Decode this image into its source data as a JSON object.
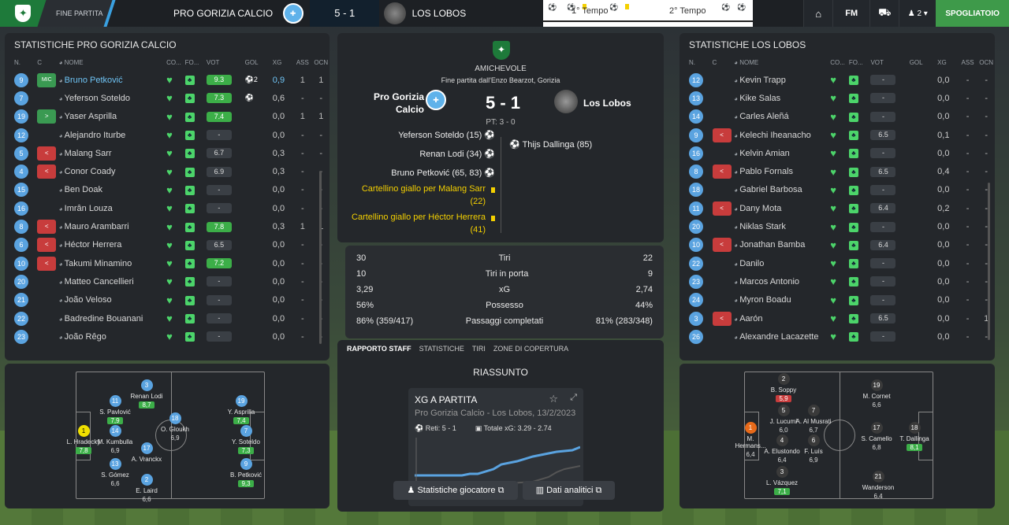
{
  "topbar": {
    "status": "FINE PARTITA",
    "home": "PRO GORIZIA CALCIO",
    "score": "5 - 1",
    "away": "LOS LOBOS",
    "first_half": "1° Tempo",
    "second_half": "2° Tempo",
    "fm": "FM",
    "inbox_count": "2",
    "spogliatoio": "SPOGLIATOIO"
  },
  "left": {
    "title": "STATISTICHE PRO GORIZIA CALCIO",
    "headers": {
      "n": "N.",
      "c": "C",
      "nome": "NOME",
      "co": "CO...",
      "fo": "FO...",
      "vot": "VOT",
      "gol": "GOL",
      "xg": "XG",
      "ass": "ASS",
      "ocn": "OCN"
    },
    "rows": [
      {
        "n": "9",
        "sub": "MIC",
        "name": "Bruno Petković",
        "vot": "9.3",
        "gol": "2",
        "xg": "0,9",
        "ass": "1",
        "ocn": "1"
      },
      {
        "n": "7",
        "sub": "",
        "name": "Yeferson Soteldo",
        "vot": "7.3",
        "gol": "1",
        "xg": "0,6",
        "ass": "-",
        "ocn": "-"
      },
      {
        "n": "19",
        "sub": ">",
        "name": "Yaser Asprilla",
        "vot": "7.4",
        "gol": "",
        "xg": "0,0",
        "ass": "1",
        "ocn": "1"
      },
      {
        "n": "12",
        "sub": "",
        "name": "Alejandro Iturbe",
        "vot": "-",
        "gol": "",
        "xg": "0,0",
        "ass": "-",
        "ocn": "-"
      },
      {
        "n": "5",
        "sub": "<",
        "name": "Malang Sarr",
        "vot": "6.7",
        "gol": "",
        "xg": "0,3",
        "ass": "-",
        "ocn": "-"
      },
      {
        "n": "4",
        "sub": "<",
        "name": "Conor Coady",
        "vot": "6.9",
        "gol": "",
        "xg": "0,3",
        "ass": "-",
        "ocn": "-"
      },
      {
        "n": "15",
        "sub": "",
        "name": "Ben Doak",
        "vot": "-",
        "gol": "",
        "xg": "0,0",
        "ass": "-",
        "ocn": "-"
      },
      {
        "n": "16",
        "sub": "",
        "name": "Imrân Louza",
        "vot": "-",
        "gol": "",
        "xg": "0,0",
        "ass": "-",
        "ocn": "-"
      },
      {
        "n": "8",
        "sub": "<",
        "name": "Mauro Arambarri",
        "vot": "7.8",
        "gol": "",
        "xg": "0,3",
        "ass": "1",
        "ocn": "1"
      },
      {
        "n": "6",
        "sub": "<",
        "name": "Héctor Herrera",
        "vot": "6.5",
        "gol": "",
        "xg": "0,0",
        "ass": "-",
        "ocn": "-"
      },
      {
        "n": "10",
        "sub": "<",
        "name": "Takumi Minamino",
        "vot": "7.2",
        "gol": "",
        "xg": "0,0",
        "ass": "-",
        "ocn": "-"
      },
      {
        "n": "20",
        "sub": "",
        "name": "Matteo Cancellieri",
        "vot": "-",
        "gol": "",
        "xg": "0,0",
        "ass": "-",
        "ocn": "-"
      },
      {
        "n": "21",
        "sub": "",
        "name": "João Veloso",
        "vot": "-",
        "gol": "",
        "xg": "0,0",
        "ass": "-",
        "ocn": "-"
      },
      {
        "n": "22",
        "sub": "",
        "name": "Badredine Bouanani",
        "vot": "-",
        "gol": "",
        "xg": "0,0",
        "ass": "-",
        "ocn": "-"
      },
      {
        "n": "23",
        "sub": "",
        "name": "João Rêgo",
        "vot": "-",
        "gol": "",
        "xg": "0,0",
        "ass": "-",
        "ocn": "-"
      }
    ],
    "pitch": [
      {
        "n": "3",
        "name": "Renan Lodi",
        "rt": "8,7",
        "g": true
      },
      {
        "n": "11",
        "name": "S. Pavlović",
        "rt": "7,9",
        "g": true
      },
      {
        "n": "14",
        "name": "M. Kumbulla",
        "rt": "6,9",
        "g": false
      },
      {
        "n": "1",
        "name": "L. Hradecký",
        "rt": "7,8",
        "g": true
      },
      {
        "n": "13",
        "name": "S. Gómez",
        "rt": "6,6",
        "g": false
      },
      {
        "n": "2",
        "name": "E. Laird",
        "rt": "6,6",
        "g": false
      },
      {
        "n": "18",
        "name": "O. Gloukh",
        "rt": "6,9",
        "g": false
      },
      {
        "n": "17",
        "name": "A. Vranckx",
        "rt": "",
        "g": false
      },
      {
        "n": "19",
        "name": "Y. Asprilla",
        "rt": "7,4",
        "g": true
      },
      {
        "n": "7",
        "name": "Y. Soteldo",
        "rt": "7,3",
        "g": true
      },
      {
        "n": "9",
        "name": "B. Petković",
        "rt": "9,3",
        "g": true
      }
    ]
  },
  "center": {
    "competition": "AMICHEVOLE",
    "venue": "Fine partita dall'Enzo Bearzot, Gorizia",
    "home1": "Pro Gorizia",
    "home2": "Calcio",
    "score": "5 - 1",
    "away": "Los Lobos",
    "ht": "PT: 3 - 0",
    "events_home": [
      "Yeferson Soteldo (15)",
      "Renan Lodi (34)",
      "Bruno Petković (65, 83)"
    ],
    "cards": [
      "Cartellino giallo per Malang Sarr (22)",
      "Cartellino giallo per Héctor Herrera (41)"
    ],
    "events_away": [
      "Thijs Dallinga (85)"
    ],
    "stats": [
      {
        "h": "30",
        "label": "Tiri",
        "a": "22"
      },
      {
        "h": "10",
        "label": "Tiri in porta",
        "a": "9"
      },
      {
        "h": "3,29",
        "label": "xG",
        "a": "2,74"
      },
      {
        "h": "56%",
        "label": "Possesso",
        "a": "44%"
      },
      {
        "h": "86% (359/417)",
        "label": "Passaggi completati",
        "a": "81% (283/348)"
      }
    ],
    "tabs": [
      "RAPPORTO STAFF",
      "STATISTICHE",
      "TIRI",
      "ZONE DI COPERTURA"
    ],
    "riassunto": "RIASSUNTO",
    "xg_title": "XG A PARTITA",
    "xg_sub": "Pro Gorizia Calcio - Los Lobos, 13/2/2023",
    "xg_reti": "Reti: 5 - 1",
    "xg_tot": "Totale xG: 3.29 - 2.74",
    "btn_players": "Statistiche giocatore",
    "btn_data": "Dati analitici"
  },
  "right": {
    "title": "STATISTICHE LOS LOBOS",
    "rows": [
      {
        "n": "12",
        "sub": "",
        "name": "Kevin Trapp",
        "vot": "-",
        "xg": "0,0",
        "ass": "-",
        "ocn": "-"
      },
      {
        "n": "13",
        "sub": "",
        "name": "Kike Salas",
        "vot": "-",
        "xg": "0,0",
        "ass": "-",
        "ocn": "-"
      },
      {
        "n": "14",
        "sub": "",
        "name": "Carles Aleñá",
        "vot": "-",
        "xg": "0,0",
        "ass": "-",
        "ocn": "-"
      },
      {
        "n": "9",
        "sub": "<",
        "name": "Kelechi Iheanacho",
        "vot": "6.5",
        "xg": "0,1",
        "ass": "-",
        "ocn": "-"
      },
      {
        "n": "16",
        "sub": "",
        "name": "Kelvin Amian",
        "vot": "-",
        "xg": "0,0",
        "ass": "-",
        "ocn": "-"
      },
      {
        "n": "8",
        "sub": "<",
        "name": "Pablo Fornals",
        "vot": "6.5",
        "xg": "0,4",
        "ass": "-",
        "ocn": "-"
      },
      {
        "n": "18",
        "sub": "",
        "name": "Gabriel Barbosa",
        "vot": "-",
        "xg": "0,0",
        "ass": "-",
        "ocn": "-"
      },
      {
        "n": "11",
        "sub": "<",
        "name": "Dany Mota",
        "vot": "6.4",
        "xg": "0,2",
        "ass": "-",
        "ocn": "-"
      },
      {
        "n": "20",
        "sub": "",
        "name": "Niklas Stark",
        "vot": "-",
        "xg": "0,0",
        "ass": "-",
        "ocn": "-"
      },
      {
        "n": "10",
        "sub": "<",
        "name": "Jonathan Bamba",
        "vot": "6.4",
        "xg": "0,0",
        "ass": "-",
        "ocn": "-"
      },
      {
        "n": "22",
        "sub": "",
        "name": "Danilo",
        "vot": "-",
        "xg": "0,0",
        "ass": "-",
        "ocn": "-"
      },
      {
        "n": "23",
        "sub": "",
        "name": "Marcos Antonio",
        "vot": "-",
        "xg": "0,0",
        "ass": "-",
        "ocn": "-"
      },
      {
        "n": "24",
        "sub": "",
        "name": "Myron Boadu",
        "vot": "-",
        "xg": "0,0",
        "ass": "-",
        "ocn": "-"
      },
      {
        "n": "3",
        "sub": "<",
        "name": "Aarón",
        "vot": "6.5",
        "xg": "0,0",
        "ass": "-",
        "ocn": "1"
      },
      {
        "n": "26",
        "sub": "",
        "name": "Alexandre Lacazette",
        "vot": "-",
        "xg": "0,0",
        "ass": "-",
        "ocn": "-"
      }
    ],
    "pitch": [
      {
        "n": "2",
        "name": "B. Soppy",
        "rt": "5,9",
        "c": "r"
      },
      {
        "n": "5",
        "name": "J. Lucumí",
        "rt": "6,0",
        "c": ""
      },
      {
        "n": "1",
        "name": "M. Hermans...",
        "rt": "6,4",
        "c": ""
      },
      {
        "n": "4",
        "name": "A. Elustondo",
        "rt": "6,4",
        "c": ""
      },
      {
        "n": "3",
        "name": "L. Vázquez",
        "rt": "7,1",
        "c": "g"
      },
      {
        "n": "7",
        "name": "A. Al Musrati",
        "rt": "6,7",
        "c": ""
      },
      {
        "n": "6",
        "name": "F. Luís",
        "rt": "6,9",
        "c": ""
      },
      {
        "n": "19",
        "name": "M. Cornet",
        "rt": "6,6",
        "c": ""
      },
      {
        "n": "17",
        "name": "S. Camello",
        "rt": "6,8",
        "c": ""
      },
      {
        "n": "21",
        "name": "Wanderson",
        "rt": "6,4",
        "c": ""
      },
      {
        "n": "18",
        "name": "T. Dallinga",
        "rt": "8,1",
        "c": "g"
      }
    ]
  }
}
